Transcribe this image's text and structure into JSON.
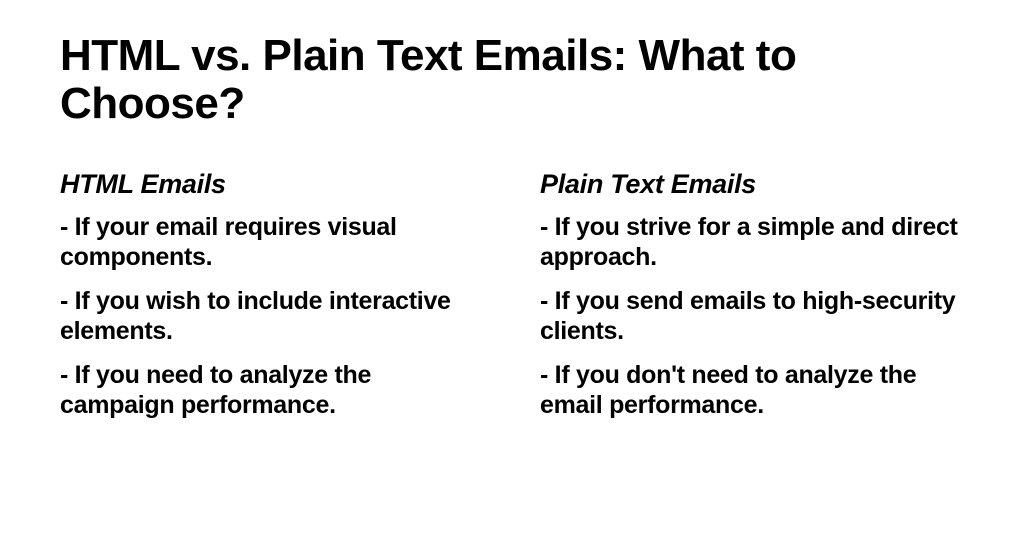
{
  "title": "HTML vs. Plain Text Emails: What to Choose?",
  "columns": {
    "left": {
      "heading": "HTML Emails",
      "items": [
        "- If your email requires visual components.",
        "- If you wish to include interactive elements.",
        "- If you need to analyze the campaign performance."
      ]
    },
    "right": {
      "heading": "Plain Text Emails",
      "items": [
        "- If you strive for a simple and direct approach.",
        "- If you send emails to high-security clients.",
        "- If you don't need to analyze the email performance."
      ]
    }
  }
}
